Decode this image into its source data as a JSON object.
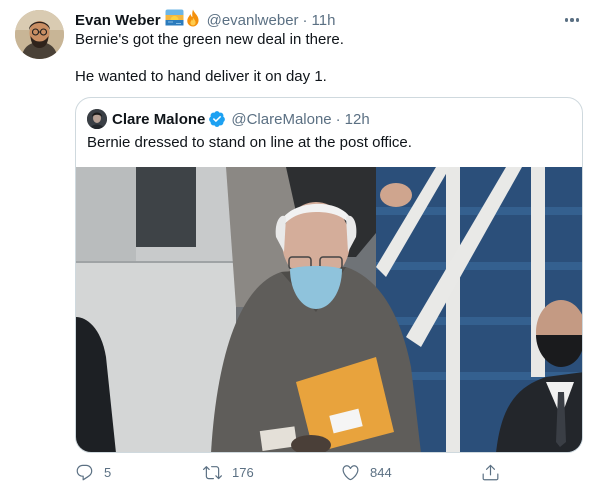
{
  "tweet": {
    "author_name": "Evan Weber",
    "emojis": [
      "sunrise-over-water-emoji",
      "fire-emoji"
    ],
    "handle": "@evanlweber",
    "separator": "·",
    "time": "11h",
    "lines": [
      "Bernie's got the green new deal in there.",
      "He wanted to hand deliver it on day 1."
    ]
  },
  "quoted": {
    "author_name": "Clare Malone",
    "verified": true,
    "handle": "@ClareMalone",
    "separator": "·",
    "time": "12h",
    "text": "Bernie dressed to stand on line at the post office.",
    "media_description_icon": "photo"
  },
  "actions": {
    "reply": {
      "icon": "reply-icon",
      "count": "5"
    },
    "retweet": {
      "icon": "retweet-icon",
      "count": "176"
    },
    "like": {
      "icon": "heart-icon",
      "count": "844"
    },
    "share": {
      "icon": "share-icon"
    }
  },
  "colors": {
    "text": "#0f1419",
    "secondary": "#5b7083",
    "border": "#cfd9de",
    "verified": "#1da1f2"
  }
}
